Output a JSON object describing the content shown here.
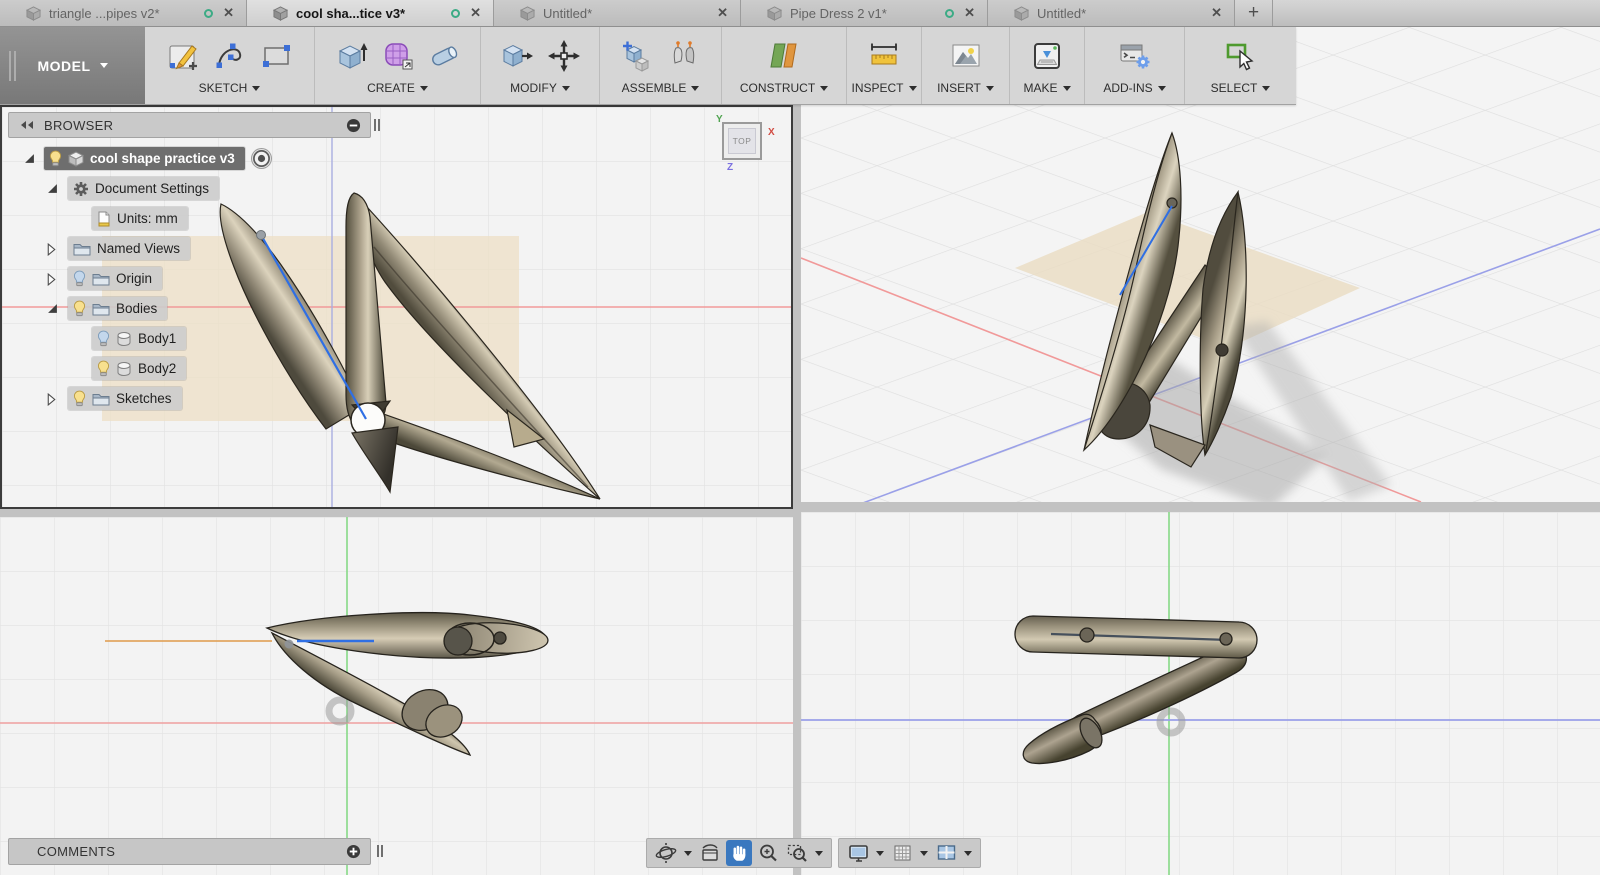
{
  "tabs": {
    "close_glyph": "✕",
    "new_tab_label": "+",
    "items": [
      {
        "label": "triangle ...pipes v2*",
        "active": false,
        "sync": true
      },
      {
        "label": "cool sha...tice v3*",
        "active": true,
        "sync": true
      },
      {
        "label": "Untitled*",
        "active": false,
        "sync": false
      },
      {
        "label": "Pipe Dress 2 v1*",
        "active": false,
        "sync": true
      },
      {
        "label": "Untitled*",
        "active": false,
        "sync": false
      }
    ]
  },
  "toolbar": {
    "workspace_label": "MODEL",
    "groups": [
      {
        "label": "SKETCH",
        "icons": [
          "create-sketch-icon",
          "spline-icon",
          "rectangle-icon"
        ]
      },
      {
        "label": "CREATE",
        "icons": [
          "extrude-icon",
          "form-icon",
          "pipe-icon"
        ]
      },
      {
        "label": "MODIFY",
        "icons": [
          "press-pull-icon",
          "move-icon"
        ]
      },
      {
        "label": "ASSEMBLE",
        "icons": [
          "new-component-icon",
          "joint-icon"
        ]
      },
      {
        "label": "CONSTRUCT",
        "icons": [
          "construction-plane-icon"
        ]
      },
      {
        "label": "INSPECT",
        "icons": [
          "measure-icon"
        ]
      },
      {
        "label": "INSERT",
        "icons": [
          "insert-image-icon"
        ]
      },
      {
        "label": "MAKE",
        "icons": [
          "3d-print-icon"
        ]
      },
      {
        "label": "ADD-INS",
        "icons": [
          "scripts-addins-icon"
        ]
      },
      {
        "label": "SELECT",
        "icons": [
          "select-cursor-icon"
        ]
      }
    ]
  },
  "browser": {
    "title": "BROWSER",
    "tree": [
      {
        "label": "cool shape practice v3",
        "type": "root-component",
        "bulb": "on",
        "selected": true
      },
      {
        "label": "Document Settings",
        "type": "settings-group"
      },
      {
        "label": "Units: mm",
        "type": "units-item"
      },
      {
        "label": "Named Views",
        "type": "folder"
      },
      {
        "label": "Origin",
        "type": "folder",
        "bulb": "off"
      },
      {
        "label": "Bodies",
        "type": "folder",
        "bulb": "on"
      },
      {
        "label": "Body1",
        "type": "body",
        "bulb": "off"
      },
      {
        "label": "Body2",
        "type": "body",
        "bulb": "on"
      },
      {
        "label": "Sketches",
        "type": "folder",
        "bulb": "on"
      }
    ]
  },
  "viewcube": {
    "face_label": "TOP",
    "axis_x": "X",
    "axis_y": "Y",
    "axis_z": "Z"
  },
  "comments": {
    "title": "COMMENTS"
  },
  "navbar": {
    "active_tool": "pan",
    "icons": [
      "orbit-icon",
      "look-at-icon",
      "pan-icon",
      "zoom-icon",
      "window-zoom-icon",
      "display-settings-icon",
      "grid-settings-icon",
      "viewports-icon"
    ]
  },
  "colors": {
    "selection_blue": "#3a78bf",
    "sync_green": "#3cab85",
    "axis_red": "#f19999",
    "axis_green": "#86d986",
    "axis_blue": "#9aa0e8",
    "sketch_blue": "#2f6fe4",
    "plane_beige": "#eee0c8",
    "pipe_olive": "#8d8572"
  }
}
